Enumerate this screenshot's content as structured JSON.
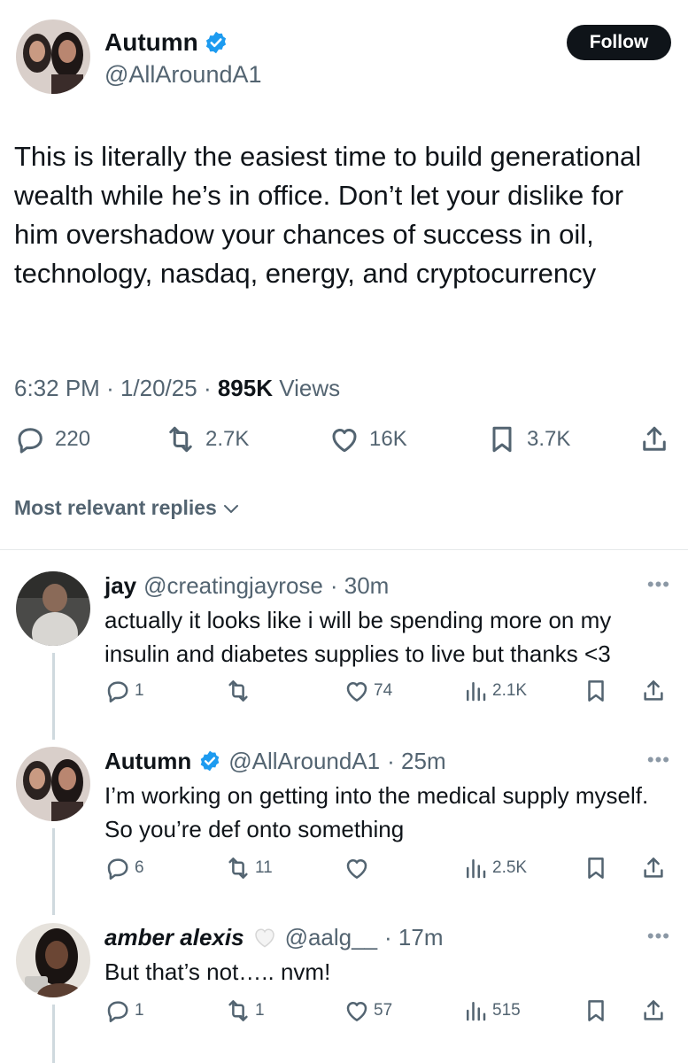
{
  "tweet": {
    "author_name": "Autumn",
    "author_handle": "@AllAroundA1",
    "follow_label": "Follow",
    "text": "This is literally the easiest time to build generational wealth while he’s in office. Don’t let your dislike for him overshadow your chances of success in oil, technology, nasdaq, energy, and cryptocurrency",
    "time": "6:32 PM",
    "date": "1/20/25",
    "views_count": "895K",
    "views_label": "Views",
    "stats": {
      "replies": "220",
      "reposts": "2.7K",
      "likes": "16K",
      "bookmarks": "3.7K"
    }
  },
  "replies_section": {
    "label": "Most relevant replies"
  },
  "replies": [
    {
      "name": "jay",
      "handle": "@creatingjayrose",
      "time": "· 30m",
      "text": "actually it looks like i will be spending more on my insulin and diabetes supplies to live but thanks <3",
      "replies": "1",
      "reposts": "",
      "likes": "74",
      "views": "2.1K"
    },
    {
      "name": "Autumn",
      "handle": "@AllAroundA1",
      "time": "· 25m",
      "text": "I’m working on getting into the medical supply myself. So you’re def onto something",
      "replies": "6",
      "reposts": "11",
      "likes": "",
      "views": "2.5K"
    },
    {
      "name": "amber alexis",
      "handle": "@aalg__",
      "time": "· 17m",
      "text": "But that’s not….. nvm!",
      "replies": "1",
      "reposts": "1",
      "likes": "57",
      "views": "515"
    }
  ],
  "colors": {
    "text_primary": "#0f1419",
    "text_secondary": "#536471",
    "verified_blue": "#1d9bf0",
    "button_dark": "#0f1419"
  }
}
